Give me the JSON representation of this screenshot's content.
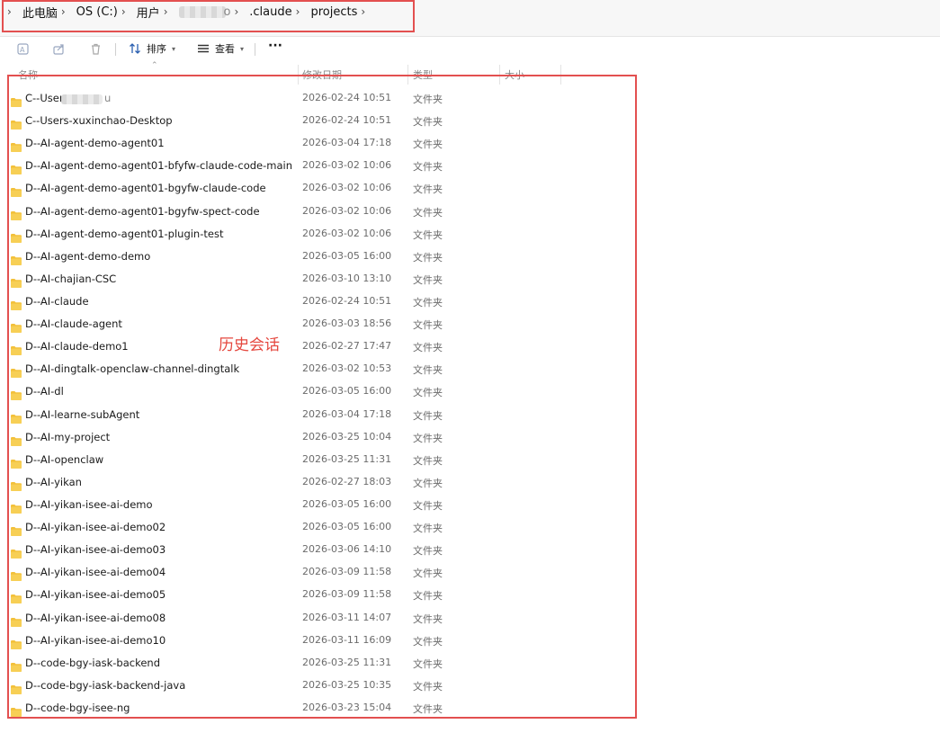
{
  "breadcrumb": {
    "items": [
      "此电脑",
      "OS (C:)",
      "用户",
      "",
      ".claude",
      "projects"
    ],
    "redacted_suffix": "o"
  },
  "toolbar": {
    "sort_label": "排序",
    "view_label": "查看",
    "more_label": "···"
  },
  "columns": {
    "name": "名称",
    "modified": "修改日期",
    "type": "类型",
    "size": "大小"
  },
  "annotation": "历史会话",
  "colors": {
    "highlight_box": "#e35050",
    "annotation_text": "#e5473e",
    "folder": "#f3c13a"
  },
  "rows": [
    {
      "name": "C--User",
      "redacted": true,
      "name_tail": "u",
      "date": "2026-02-24 10:51",
      "type": "文件夹"
    },
    {
      "name": "C--Users-xuxinchao-Desktop",
      "date": "2026-02-24 10:51",
      "type": "文件夹"
    },
    {
      "name": "D--AI-agent-demo-agent01",
      "date": "2026-03-04 17:18",
      "type": "文件夹"
    },
    {
      "name": "D--AI-agent-demo-agent01-bfyfw-claude-code-main",
      "date": "2026-03-02 10:06",
      "type": "文件夹"
    },
    {
      "name": "D--AI-agent-demo-agent01-bgyfw-claude-code",
      "date": "2026-03-02 10:06",
      "type": "文件夹"
    },
    {
      "name": "D--AI-agent-demo-agent01-bgyfw-spect-code",
      "date": "2026-03-02 10:06",
      "type": "文件夹"
    },
    {
      "name": "D--AI-agent-demo-agent01-plugin-test",
      "date": "2026-03-02 10:06",
      "type": "文件夹"
    },
    {
      "name": "D--AI-agent-demo-demo",
      "date": "2026-03-05 16:00",
      "type": "文件夹"
    },
    {
      "name": "D--AI-chajian-CSC",
      "date": "2026-03-10 13:10",
      "type": "文件夹"
    },
    {
      "name": "D--AI-claude",
      "date": "2026-02-24 10:51",
      "type": "文件夹"
    },
    {
      "name": "D--AI-claude-agent",
      "date": "2026-03-03 18:56",
      "type": "文件夹"
    },
    {
      "name": "D--AI-claude-demo1",
      "date": "2026-02-27 17:47",
      "type": "文件夹"
    },
    {
      "name": "D--AI-dingtalk-openclaw-channel-dingtalk",
      "date": "2026-03-02 10:53",
      "type": "文件夹"
    },
    {
      "name": "D--AI-dl",
      "date": "2026-03-05 16:00",
      "type": "文件夹"
    },
    {
      "name": "D--AI-learne-subAgent",
      "date": "2026-03-04 17:18",
      "type": "文件夹"
    },
    {
      "name": "D--AI-my-project",
      "date": "2026-03-25 10:04",
      "type": "文件夹"
    },
    {
      "name": "D--AI-openclaw",
      "date": "2026-03-25 11:31",
      "type": "文件夹"
    },
    {
      "name": "D--AI-yikan",
      "date": "2026-02-27 18:03",
      "type": "文件夹"
    },
    {
      "name": "D--AI-yikan-isee-ai-demo",
      "date": "2026-03-05 16:00",
      "type": "文件夹"
    },
    {
      "name": "D--AI-yikan-isee-ai-demo02",
      "date": "2026-03-05 16:00",
      "type": "文件夹"
    },
    {
      "name": "D--AI-yikan-isee-ai-demo03",
      "date": "2026-03-06 14:10",
      "type": "文件夹"
    },
    {
      "name": "D--AI-yikan-isee-ai-demo04",
      "date": "2026-03-09 11:58",
      "type": "文件夹"
    },
    {
      "name": "D--AI-yikan-isee-ai-demo05",
      "date": "2026-03-09 11:58",
      "type": "文件夹"
    },
    {
      "name": "D--AI-yikan-isee-ai-demo08",
      "date": "2026-03-11 14:07",
      "type": "文件夹"
    },
    {
      "name": "D--AI-yikan-isee-ai-demo10",
      "date": "2026-03-11 16:09",
      "type": "文件夹"
    },
    {
      "name": "D--code-bgy-iask-backend",
      "date": "2026-03-25 11:31",
      "type": "文件夹"
    },
    {
      "name": "D--code-bgy-iask-backend-java",
      "date": "2026-03-25 10:35",
      "type": "文件夹"
    },
    {
      "name": "D--code-bgy-isee-ng",
      "date": "2026-03-23 15:04",
      "type": "文件夹"
    }
  ]
}
